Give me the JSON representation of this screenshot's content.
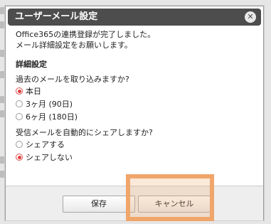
{
  "dialog": {
    "title": "ユーザーメール設定",
    "close_symbol": "✕",
    "message_line1": "Office365の連携登録が完了しました。",
    "message_line2": "メール詳細設定をお願いします。",
    "section_title": "詳細設定",
    "question1": "過去のメールを取り込みますか?",
    "options1": [
      "本日",
      "3ヶ月 (90日)",
      "6ヶ月 (180日)"
    ],
    "selected1": "本日",
    "question2": "受信メールを自動的にシェアしますか?",
    "options2": [
      "シェアする",
      "シェアしない"
    ],
    "selected2": "シェアしない",
    "buttons": {
      "save": "保存",
      "cancel": "キャンセル"
    }
  },
  "colors": {
    "titlebar": "#4d4d4d",
    "selected_radio": "#e23c3c",
    "highlight": "#f0a66a"
  }
}
